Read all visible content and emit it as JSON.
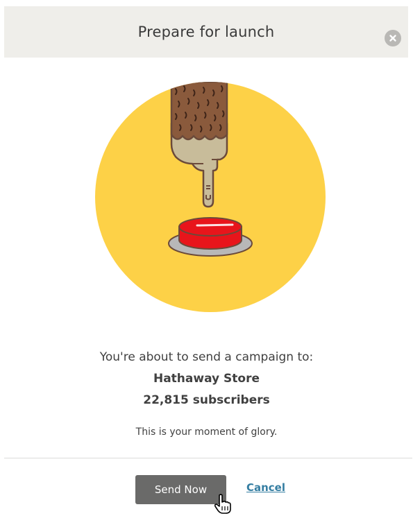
{
  "dialog": {
    "title": "Prepare for launch",
    "close_icon": "close-icon"
  },
  "illustration": {
    "icon": "finger-pressing-red-button-icon",
    "circle_color": "#fdd147",
    "button_color": "#e8151b"
  },
  "message": {
    "intro": "You're about to send a campaign to:",
    "list_name": "Hathaway Store",
    "subscribers": "22,815 subscribers",
    "tagline": "This is your moment of glory."
  },
  "actions": {
    "send_label": "Send Now",
    "cancel_label": "Cancel"
  },
  "colors": {
    "header_bg": "#efeeea",
    "send_button_bg": "#6a6a69",
    "cancel_link": "#357ea2"
  }
}
